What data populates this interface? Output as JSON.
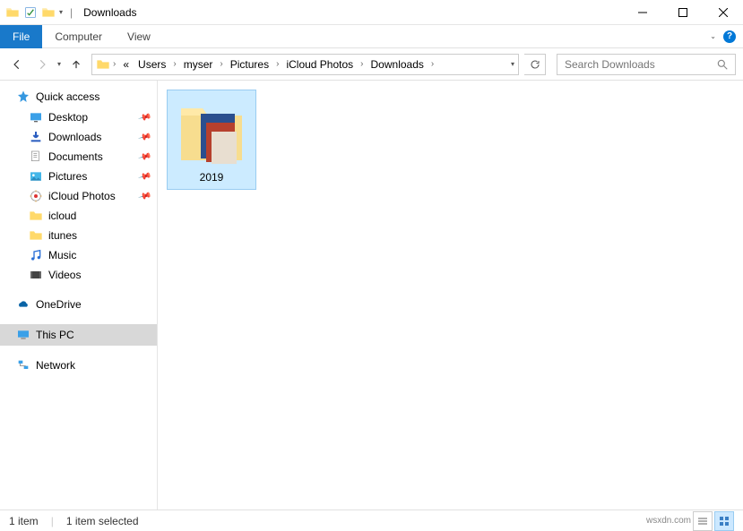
{
  "window": {
    "title": "Downloads"
  },
  "ribbon": {
    "file": "File",
    "computer": "Computer",
    "view": "View"
  },
  "breadcrumb": {
    "prefix": "«",
    "parts": [
      "Users",
      "myser",
      "Pictures",
      "iCloud Photos",
      "Downloads"
    ]
  },
  "search": {
    "placeholder": "Search Downloads"
  },
  "sidebar": {
    "quick_access": "Quick access",
    "pinned": [
      {
        "icon": "desktop",
        "label": "Desktop"
      },
      {
        "icon": "downloads",
        "label": "Downloads"
      },
      {
        "icon": "documents",
        "label": "Documents"
      },
      {
        "icon": "pictures",
        "label": "Pictures"
      },
      {
        "icon": "cloud-photos",
        "label": "iCloud Photos"
      }
    ],
    "folders": [
      {
        "label": "icloud"
      },
      {
        "label": "itunes"
      },
      {
        "label": "Music"
      },
      {
        "label": "Videos"
      }
    ],
    "onedrive": "OneDrive",
    "thispc": "This PC",
    "network": "Network"
  },
  "content": {
    "items": [
      {
        "label": "2019"
      }
    ]
  },
  "statusbar": {
    "count": "1 item",
    "selected": "1 item selected",
    "watermark": "wsxdn.com"
  }
}
